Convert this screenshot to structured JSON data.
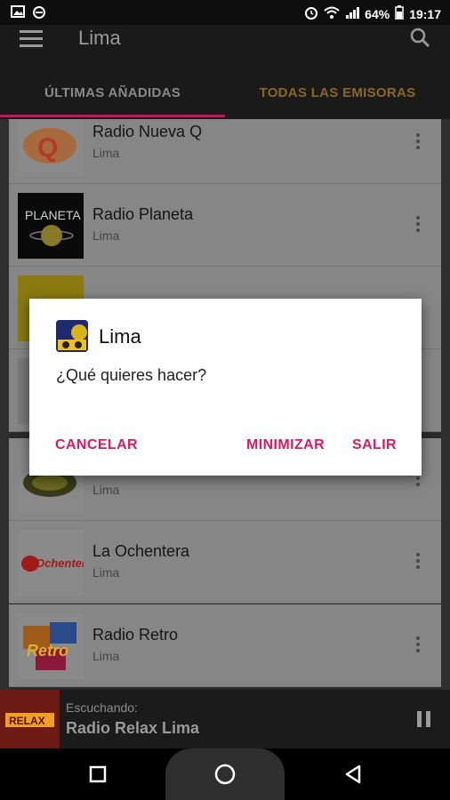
{
  "status_bar": {
    "battery": "64%",
    "time": "19:17"
  },
  "app_bar": {
    "title": "Lima"
  },
  "tabs": [
    {
      "label": "ÚLTIMAS AÑADIDAS",
      "active": true
    },
    {
      "label": "TODAS LAS EMISORAS",
      "active": false
    }
  ],
  "stations": [
    {
      "name": "Radio Nueva Q",
      "location": "Lima",
      "logo_text": "Q"
    },
    {
      "name": "Radio Planeta",
      "location": "Lima",
      "logo_text": "PLANETA"
    },
    {
      "name": "",
      "location": "",
      "logo_text": ""
    },
    {
      "name": "",
      "location": "",
      "logo_text": ""
    },
    {
      "name": "",
      "location": "Lima",
      "logo_text": ""
    },
    {
      "name": "La Ochentera",
      "location": "Lima",
      "logo_text": "Ochentera"
    },
    {
      "name": "Radio Retro",
      "location": "Lima",
      "logo_text": "Retro"
    }
  ],
  "dialog": {
    "title": "Lima",
    "message": "¿Qué quieres hacer?",
    "cancel_label": "CANCELAR",
    "minimize_label": "MINIMIZAR",
    "exit_label": "SALIR"
  },
  "player": {
    "label": "Escuchando:",
    "station": "Radio Relax Lima",
    "thumb_text": "RELAX"
  },
  "colors": {
    "accent": "#d81b60",
    "tab_inactive": "#8b6722"
  }
}
